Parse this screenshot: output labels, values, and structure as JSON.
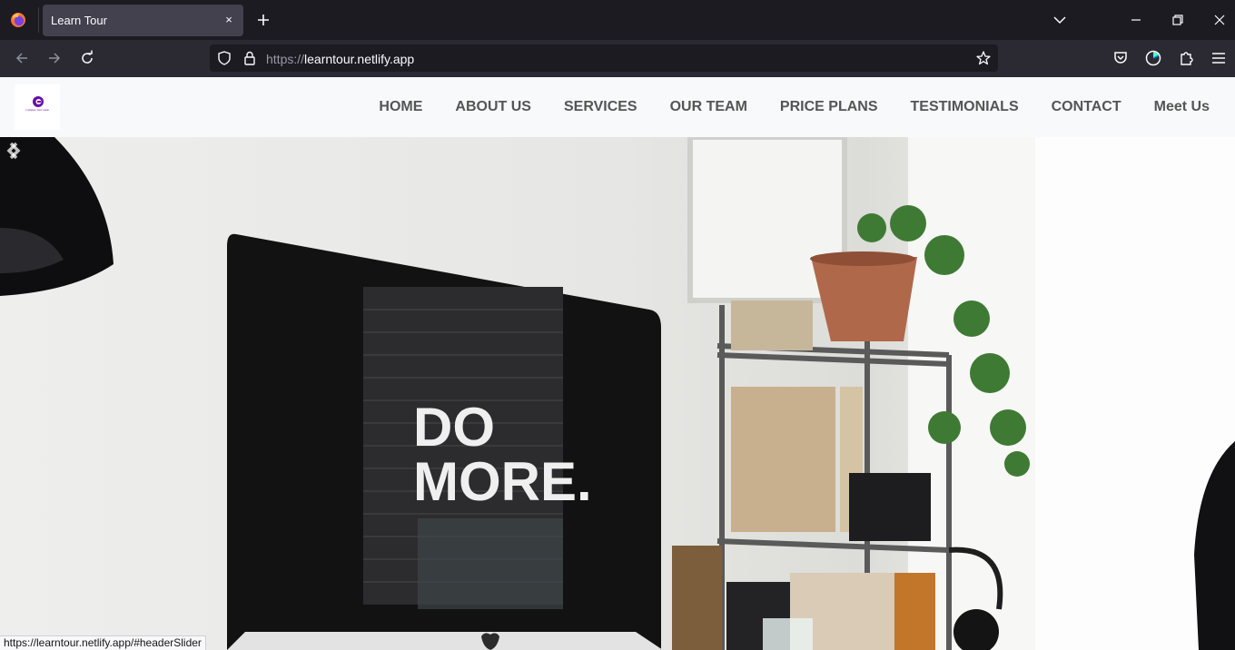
{
  "browser": {
    "tab_title": "Learn Tour",
    "tab_close_label": "×",
    "url_protocol": "https://",
    "url_host": "learntour.netlify.app",
    "status_url": "https://learntour.netlify.app/#headerSlider"
  },
  "site": {
    "logo_text": "Complete Tour Guide",
    "nav": [
      "HOME",
      "ABOUT US",
      "SERVICES",
      "OUR TEAM",
      "PRICE PLANS",
      "TESTIMONIALS",
      "CONTACT",
      "Meet Us"
    ]
  },
  "hero": {
    "screen_text_line1": "DO",
    "screen_text_line2": "MORE.",
    "prev_icon": "chevron-left-icon",
    "next_icon": "chevron-right-icon"
  },
  "colors": {
    "chrome_dark": "#1c1b22",
    "toolbar": "#2b2a33",
    "tab_active": "#42414d",
    "site_nav_bg": "#f8f9fa",
    "nav_text": "#555555",
    "logo_purple": "#6a0dad"
  }
}
